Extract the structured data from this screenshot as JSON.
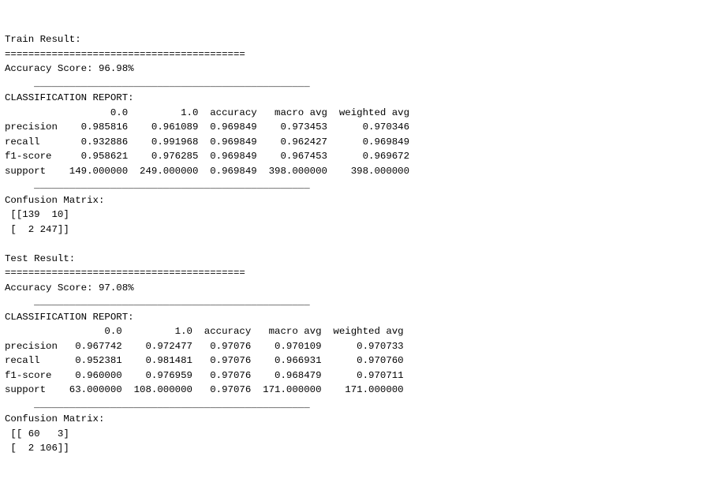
{
  "train": {
    "title": "Train Result:",
    "divider": "=========================================",
    "acc_line": "Accuracy Score: 96.98%",
    "underline": "     _______________________________________________",
    "cr_title": "CLASSIFICATION REPORT:",
    "cr_header": "                  0.0         1.0  accuracy   macro avg  weighted avg",
    "cr_precision": "precision    0.985816    0.961089  0.969849    0.973453      0.970346",
    "cr_recall": "recall       0.932886    0.991968  0.969849    0.962427      0.969849",
    "cr_f1": "f1-score     0.958621    0.976285  0.969849    0.967453      0.969672",
    "cr_support": "support    149.000000  249.000000  0.969849  398.000000    398.000000",
    "cm_title": "Confusion Matrix: ",
    "cm_row1": " [[139  10]",
    "cm_row2": " [  2 247]]"
  },
  "test": {
    "title": "Test Result:",
    "divider": "=========================================",
    "acc_line": "Accuracy Score: 97.08%",
    "underline": "     _______________________________________________",
    "cr_title": "CLASSIFICATION REPORT:",
    "cr_header": "                 0.0         1.0  accuracy   macro avg  weighted avg",
    "cr_precision": "precision   0.967742    0.972477   0.97076    0.970109      0.970733",
    "cr_recall": "recall      0.952381    0.981481   0.97076    0.966931      0.970760",
    "cr_f1": "f1-score    0.960000    0.976959   0.97076    0.968479      0.970711",
    "cr_support": "support    63.000000  108.000000   0.97076  171.000000    171.000000",
    "cm_title": "Confusion Matrix: ",
    "cm_row1": " [[ 60   3]",
    "cm_row2": " [  2 106]]"
  }
}
